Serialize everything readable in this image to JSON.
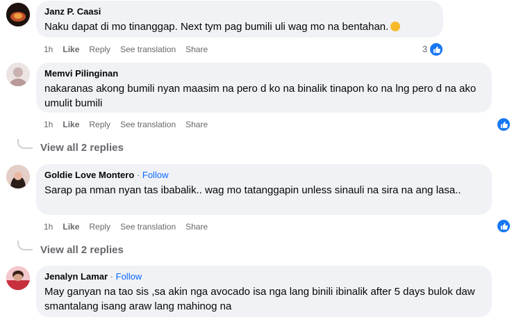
{
  "comments": [
    {
      "name": "Janz P. Caasi",
      "text": "Naku dapat di mo tinanggap. Next tym pag bumili uli wag mo na bentahan.",
      "time": "1h",
      "like": "Like",
      "reply": "Reply",
      "translate": "See translation",
      "share": "Share",
      "reactions": "3"
    },
    {
      "name": "Memvi Pilinginan",
      "text": "nakaranas akong bumili nyan maasim na pero d ko na binalik tinapon ko na lng pero d na ako umulit bumili",
      "time": "1h",
      "like": "Like",
      "reply": "Reply",
      "translate": "See translation",
      "share": "Share",
      "view_replies": "View all 2 replies"
    },
    {
      "name": "Goldie Love Montero",
      "dot": "·",
      "follow": "Follow",
      "text": "Sarap pa nman nyan tas ibabalik.. wag mo tatanggapin unless sinauli na sira na ang lasa..",
      "time": "1h",
      "like": "Like",
      "reply": "Reply",
      "translate": "See translation",
      "share": "Share",
      "view_replies": "View all 2 replies"
    },
    {
      "name": "Jenalyn Lamar",
      "dot": "·",
      "follow": "Follow",
      "text": "May ganyan na tao sis ,sa akin nga avocado isa nga lang binili ibinalik after 5 days bulok daw smantalang isang araw lang mahinog na"
    }
  ],
  "colors": {
    "link": "#0866ff",
    "bubble": "#f0f2f5",
    "meta": "#65676b",
    "like": "#1877f2"
  },
  "icons": [
    "avatar",
    "laughing-emoji-icon",
    "like-reaction-icon"
  ]
}
